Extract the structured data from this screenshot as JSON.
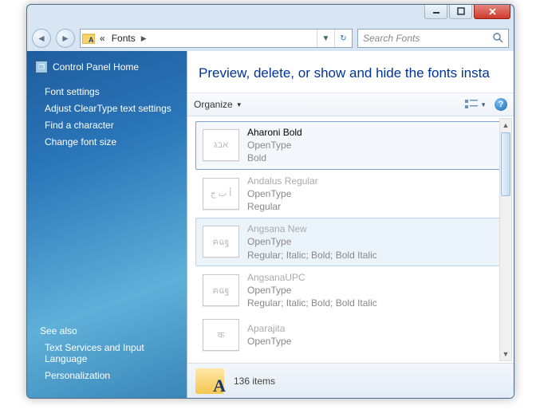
{
  "breadcrumb": {
    "prefix": "«",
    "segment": "Fonts"
  },
  "search": {
    "placeholder": "Search Fonts"
  },
  "sidebar": {
    "home": "Control Panel Home",
    "links": [
      "Font settings",
      "Adjust ClearType text settings",
      "Find a character",
      "Change font size"
    ],
    "seealso_hdr": "See also",
    "seealso": [
      "Text Services and Input Language",
      "Personalization"
    ]
  },
  "heading": "Preview, delete, or show and hide the fonts insta",
  "toolbar": {
    "organize": "Organize"
  },
  "fonts": [
    {
      "name": "Aharoni Bold",
      "type": "OpenType",
      "style": "Bold",
      "sample": "אבג",
      "state": "sel"
    },
    {
      "name": "Andalus Regular",
      "type": "OpenType",
      "style": "Regular",
      "sample": "أ ب ج",
      "state": "dim"
    },
    {
      "name": "Angsana New",
      "type": "OpenType",
      "style": "Regular; Italic; Bold; Bold Italic",
      "sample": "ฅฉฐ",
      "state": "hov dim"
    },
    {
      "name": "AngsanaUPC",
      "type": "OpenType",
      "style": "Regular; Italic; Bold; Bold Italic",
      "sample": "ฅฉฐ",
      "state": "dim"
    },
    {
      "name": "Aparajita",
      "type": "OpenType",
      "style": "",
      "sample": "क",
      "state": "dim"
    }
  ],
  "status": {
    "count": "136 items"
  }
}
